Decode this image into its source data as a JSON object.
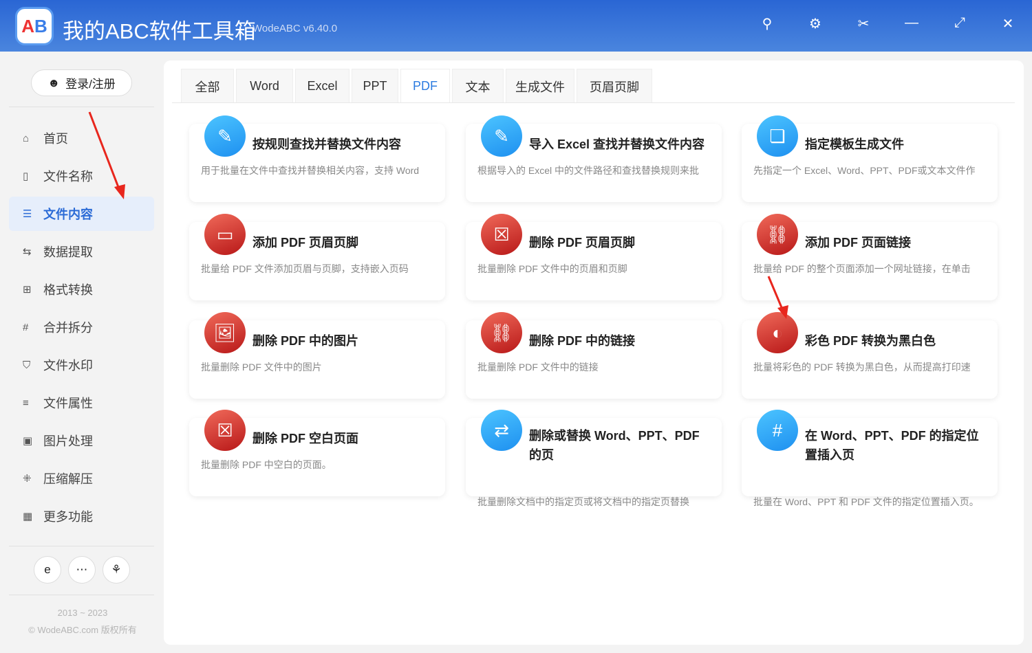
{
  "app": {
    "title": "我的ABC软件工具箱",
    "version": "WodeABC v6.40.0",
    "logo_text": "AB"
  },
  "header_icons": [
    "search-icon",
    "gear-icon",
    "scissors-icon",
    "minimize-icon",
    "maximize-icon",
    "close-icon"
  ],
  "sidebar": {
    "login": "登录/注册",
    "items": [
      {
        "label": "首页",
        "icon": "home-icon"
      },
      {
        "label": "文件名称",
        "icon": "file-icon"
      },
      {
        "label": "文件内容",
        "icon": "list-icon",
        "active": true
      },
      {
        "label": "数据提取",
        "icon": "extract-icon"
      },
      {
        "label": "格式转换",
        "icon": "convert-icon"
      },
      {
        "label": "合并拆分",
        "icon": "hash-icon"
      },
      {
        "label": "文件水印",
        "icon": "shield-icon"
      },
      {
        "label": "文件属性",
        "icon": "properties-icon"
      },
      {
        "label": "图片处理",
        "icon": "image-icon"
      },
      {
        "label": "压缩解压",
        "icon": "compress-icon"
      },
      {
        "label": "更多功能",
        "icon": "grid-icon"
      }
    ],
    "years": "2013 ~ 2023",
    "copyright": "© WodeABC.com 版权所有"
  },
  "tabs": [
    {
      "label": "全部"
    },
    {
      "label": "Word"
    },
    {
      "label": "Excel"
    },
    {
      "label": "PPT"
    },
    {
      "label": "PDF",
      "active": true
    },
    {
      "label": "文本"
    },
    {
      "label": "生成文件"
    },
    {
      "label": "页眉页脚"
    }
  ],
  "cards": [
    {
      "title": "按规则查找并替换文件内容",
      "desc": "用于批量在文件中查找并替换相关内容，支持 Word",
      "color": "blue"
    },
    {
      "title": "导入 Excel 查找并替换文件内容",
      "desc": "根据导入的 Excel 中的文件路径和查找替换规则来批",
      "color": "blue"
    },
    {
      "title": "指定模板生成文件",
      "desc": "先指定一个 Excel、Word、PPT、PDF或文本文件作",
      "color": "blue"
    },
    {
      "title": "添加 PDF 页眉页脚",
      "desc": "批量给 PDF 文件添加页眉与页脚，支持嵌入页码",
      "color": "red"
    },
    {
      "title": "删除 PDF 页眉页脚",
      "desc": "批量删除 PDF 文件中的页眉和页脚",
      "color": "red"
    },
    {
      "title": "添加 PDF 页面链接",
      "desc": "批量给 PDF 的整个页面添加一个网址链接，在单击",
      "color": "red"
    },
    {
      "title": "删除 PDF 中的图片",
      "desc": "批量删除 PDF 文件中的图片",
      "color": "red"
    },
    {
      "title": "删除 PDF 中的链接",
      "desc": "批量删除 PDF 文件中的链接",
      "color": "red"
    },
    {
      "title": "彩色 PDF 转换为黑白色",
      "desc": "批量将彩色的 PDF 转换为黑白色，从而提高打印速",
      "color": "red"
    },
    {
      "title": "删除 PDF 空白页面",
      "desc": "批量删除 PDF 中空白的页面。",
      "color": "red"
    },
    {
      "title": "删除或替换 Word、PPT、PDF 的页",
      "desc": "批量删除文档中的指定页或将文档中的指定页替换",
      "color": "blue"
    },
    {
      "title": "在 Word、PPT、PDF 的指定位置插入页",
      "desc": "批量在 Word、PPT 和 PDF 文件的指定位置插入页。",
      "color": "blue"
    }
  ]
}
